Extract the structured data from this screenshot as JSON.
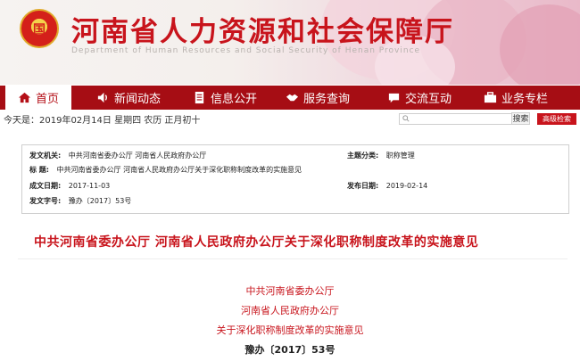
{
  "header": {
    "site_title": "河南省人力资源和社会保障厅",
    "site_subtitle": "Department of Human Resources and Social Security of Henan Province",
    "emblem_text": "国"
  },
  "nav": {
    "items": [
      {
        "label": "首页",
        "icon": "home-icon"
      },
      {
        "label": "新闻动态",
        "icon": "speaker-icon"
      },
      {
        "label": "信息公开",
        "icon": "document-icon"
      },
      {
        "label": "服务查询",
        "icon": "handshake-icon"
      },
      {
        "label": "交流互动",
        "icon": "chat-icon"
      },
      {
        "label": "业务专栏",
        "icon": "briefcase-icon"
      }
    ],
    "active_index": 0
  },
  "infobar": {
    "date_text": "今天是：2019年02月14日  星期四  农历 正月初十",
    "search_placeholder": "",
    "search_button": "搜索",
    "advanced_button": "高级检索"
  },
  "meta": {
    "issuer_label": "发文机关:",
    "issuer_value": "中共河南省委办公厅    河南省人民政府办公厅",
    "category_label": "主题分类:",
    "category_value": "职称管理",
    "title_label": "标      题:",
    "title_value": "中共河南省委办公厅  河南省人民政府办公厅关于深化职称制度改革的实施意见",
    "created_label": "成文日期:",
    "created_value": "2017-11-03",
    "published_label": "发布日期:",
    "published_value": "2019-02-14",
    "docno_label": "发文字号:",
    "docno_value": "豫办〔2017〕53号"
  },
  "article": {
    "title": "中共河南省委办公厅    河南省人民政府办公厅关于深化职称制度改革的实施意见",
    "lines": [
      "中共河南省委办公厅",
      "河南省人民政府办公厅",
      "关于深化职称制度改革的实施意见"
    ],
    "doc_number": "豫办〔2017〕53号"
  },
  "colors": {
    "brand_red": "#c8141c",
    "nav_red": "#a60d14"
  }
}
